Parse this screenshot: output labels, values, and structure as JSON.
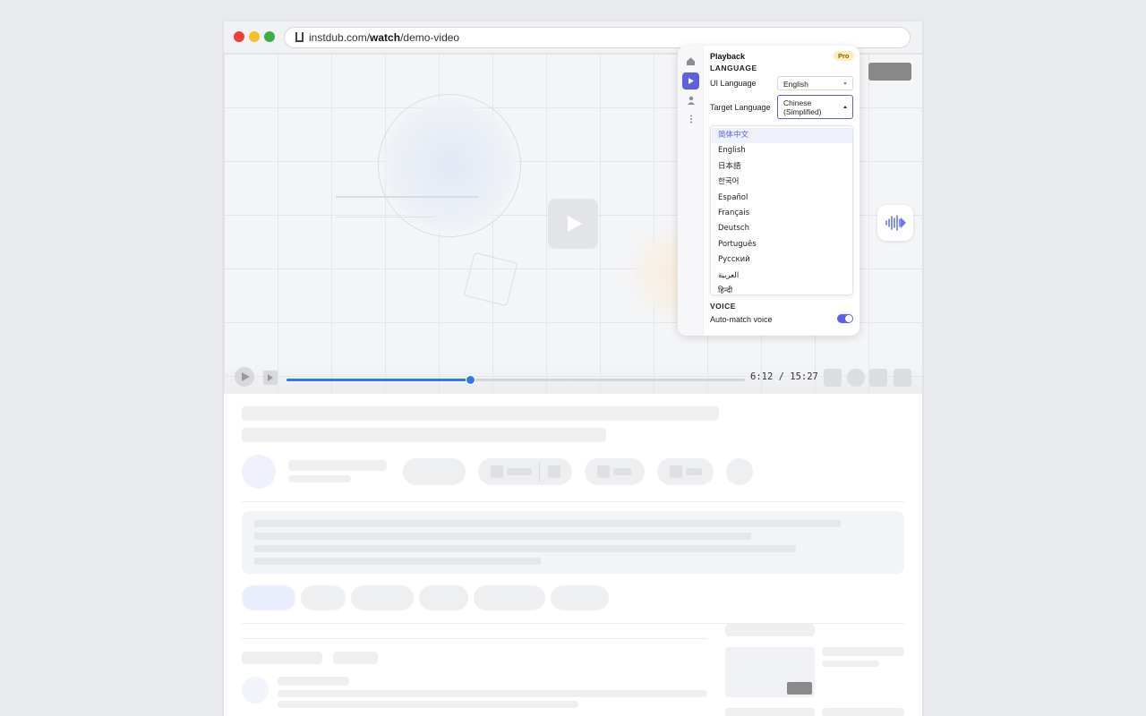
{
  "browser": {
    "url_prefix": "instdub.com/",
    "url_bold": "watch",
    "url_suffix": "/demo-video"
  },
  "player": {
    "time_display": "6:12 / 15:27",
    "progress_fraction": 0.4,
    "accent_color": "#2f7ae5"
  },
  "panel": {
    "title": "Playback",
    "badge": "Pro",
    "accent_color": "#5b5fe0",
    "rail_icons": [
      "home-icon",
      "play-icon",
      "user-icon",
      "more-icon"
    ],
    "language_section": "LANGUAGE",
    "ui_language_label": "UI Language",
    "ui_language_value": "English",
    "target_language_label": "Target Language",
    "target_language_value": "Chinese (Simplified)",
    "options": [
      "简体中文",
      "English",
      "日本語",
      "한국어",
      "Español",
      "Français",
      "Deutsch",
      "Português",
      "Русский",
      "العربية",
      "हिन्दी"
    ],
    "selected_option": "简体中文",
    "voice_section": "VOICE",
    "auto_match_label": "Auto-match voice",
    "auto_match_on": true
  }
}
